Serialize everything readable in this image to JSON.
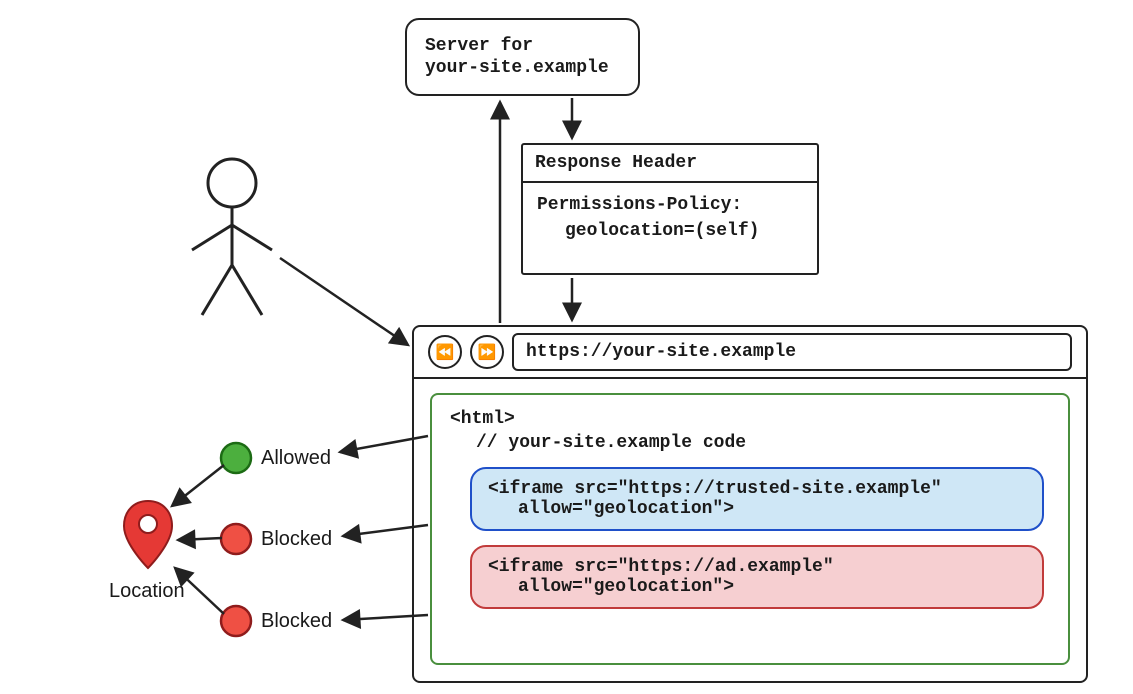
{
  "server": {
    "line1": "Server for",
    "line2": "your-site.example"
  },
  "response_header": {
    "title": "Response Header",
    "line1": "Permissions-Policy:",
    "line2": "geolocation=(self)"
  },
  "browser": {
    "url": "https://your-site.example",
    "page": {
      "html_tag": "<html>",
      "comment": "// your-site.example code",
      "iframe1_line1": "<iframe src=\"https://trusted-site.example\"",
      "iframe1_line2": "allow=\"geolocation\">",
      "iframe2_line1": "<iframe src=\"https://ad.example\"",
      "iframe2_line2": "allow=\"geolocation\">"
    }
  },
  "status": {
    "allowed": "Allowed",
    "blocked1": "Blocked",
    "blocked2": "Blocked"
  },
  "location_label": "Location"
}
